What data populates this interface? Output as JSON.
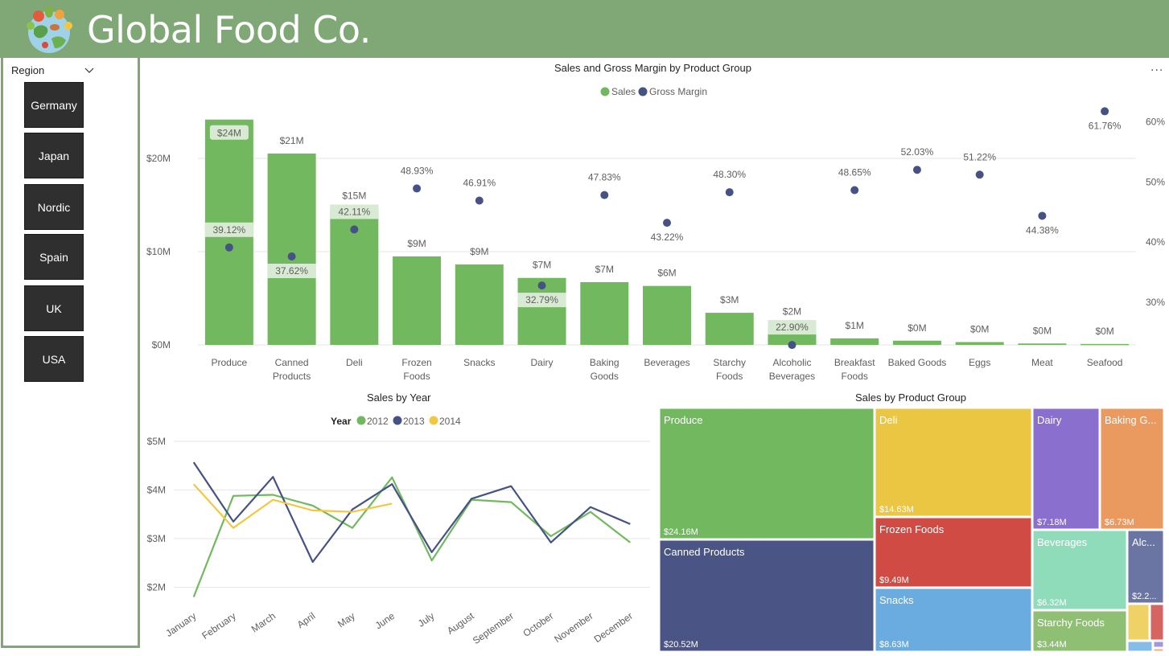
{
  "app": {
    "title": "Global Food Co."
  },
  "colors": {
    "header": "#80a876",
    "sales": "#72b85f",
    "margin": "#465284",
    "label_bg": "#d8ead3"
  },
  "slicer": {
    "header": "Region",
    "items": [
      {
        "label": "Germany"
      },
      {
        "label": "Japan"
      },
      {
        "label": "Nordic"
      },
      {
        "label": "Spain"
      },
      {
        "label": "UK"
      },
      {
        "label": "USA"
      }
    ]
  },
  "main_chart": {
    "more_options": "..."
  },
  "chart_data": [
    {
      "type": "bar",
      "title": "Sales and Gross Margin by Product Group",
      "legend": [
        "Sales",
        "Gross Margin"
      ],
      "legend_position": "top-center",
      "categories": [
        "Produce",
        "Canned Products",
        "Deli",
        "Frozen Foods",
        "Snacks",
        "Dairy",
        "Baking Goods",
        "Beverages",
        "Starchy Foods",
        "Alcoholic Beverages",
        "Breakfast Foods",
        "Baked Goods",
        "Eggs",
        "Meat",
        "Seafood"
      ],
      "series": [
        {
          "name": "Sales",
          "type": "bar",
          "axis": "left",
          "values": [
            24.16,
            20.52,
            14.63,
            9.49,
            8.63,
            7.18,
            6.73,
            6.32,
            3.44,
            2.2,
            0.7,
            0.45,
            0.3,
            0.15,
            0.1
          ],
          "labels": [
            "$24M",
            "$21M",
            "$15M",
            "$9M",
            "$9M",
            "$7M",
            "$7M",
            "$6M",
            "$3M",
            "$2M",
            "$1M",
            "$0M",
            "$0M",
            "$0M",
            "$0M"
          ]
        },
        {
          "name": "Gross Margin",
          "type": "scatter",
          "axis": "right",
          "values": [
            39.12,
            37.62,
            42.11,
            48.93,
            46.91,
            32.79,
            47.83,
            43.22,
            48.3,
            22.9,
            48.65,
            52.03,
            51.22,
            44.38,
            61.76
          ],
          "labels": [
            "39.12%",
            "37.62%",
            "42.11%",
            "48.93%",
            "46.91%",
            "32.79%",
            "47.83%",
            "43.22%",
            "48.30%",
            "22.90%",
            "48.65%",
            "52.03%",
            "51.22%",
            "44.38%",
            "61.76%"
          ]
        }
      ],
      "left_ticks": [
        "$0M",
        "$10M",
        "$20M"
      ],
      "right_ticks": [
        "30%",
        "40%",
        "50%",
        "60%"
      ],
      "grid": true
    },
    {
      "type": "line",
      "title": "Sales by Year",
      "legend_title": "Year",
      "legend_position": "top-left",
      "categories": [
        "January",
        "February",
        "March",
        "April",
        "May",
        "June",
        "July",
        "August",
        "September",
        "October",
        "November",
        "December"
      ],
      "series": [
        {
          "name": "2012",
          "color": "#72b85f",
          "values": [
            1.8,
            3.88,
            3.9,
            3.68,
            3.22,
            4.26,
            2.55,
            3.8,
            3.75,
            3.05,
            3.55,
            2.92
          ]
        },
        {
          "name": "2013",
          "color": "#465284",
          "values": [
            4.57,
            3.35,
            4.27,
            2.52,
            3.6,
            4.12,
            2.72,
            3.82,
            4.08,
            2.92,
            3.65,
            3.3
          ]
        },
        {
          "name": "2014",
          "color": "#f0c842",
          "values": [
            4.12,
            3.22,
            3.8,
            3.58,
            3.55,
            3.72
          ]
        }
      ],
      "y_ticks": [
        "$2M",
        "$3M",
        "$4M",
        "$5M"
      ],
      "ylim": [
        1.7,
        5.3
      ],
      "grid": true
    },
    {
      "type": "treemap",
      "title": "Sales by Product Group",
      "items": [
        {
          "label": "Produce",
          "value_label": "$24.16M",
          "color": "#72b85f"
        },
        {
          "label": "Canned Products",
          "value_label": "$20.52M",
          "color": "#4a5586"
        },
        {
          "label": "Deli",
          "value_label": "$14.63M",
          "color": "#eac643"
        },
        {
          "label": "Frozen Foods",
          "value_label": "$9.49M",
          "color": "#d04b44"
        },
        {
          "label": "Snacks",
          "value_label": "$8.63M",
          "color": "#6aace0"
        },
        {
          "label": "Dairy",
          "value_label": "$7.18M",
          "color": "#8b6fcf"
        },
        {
          "label": "Baking G...",
          "value_label": "$6.73M",
          "color": "#ea9a5e"
        },
        {
          "label": "Beverages",
          "value_label": "$6.32M",
          "color": "#8fdcbb"
        },
        {
          "label": "Starchy Foods",
          "value_label": "$3.44M",
          "color": "#8fbf73"
        },
        {
          "label": "Alc...",
          "value_label": "$2.2...",
          "color": "#6a75a3"
        },
        {
          "label": "",
          "value_label": "",
          "color": "#efd266"
        },
        {
          "label": "",
          "value_label": "",
          "color": "#d46561"
        },
        {
          "label": "",
          "value_label": "",
          "color": "#85bde8"
        },
        {
          "label": "",
          "value_label": "",
          "color": "#a595db"
        },
        {
          "label": "",
          "value_label": "",
          "color": "#f0b07a"
        }
      ]
    }
  ]
}
